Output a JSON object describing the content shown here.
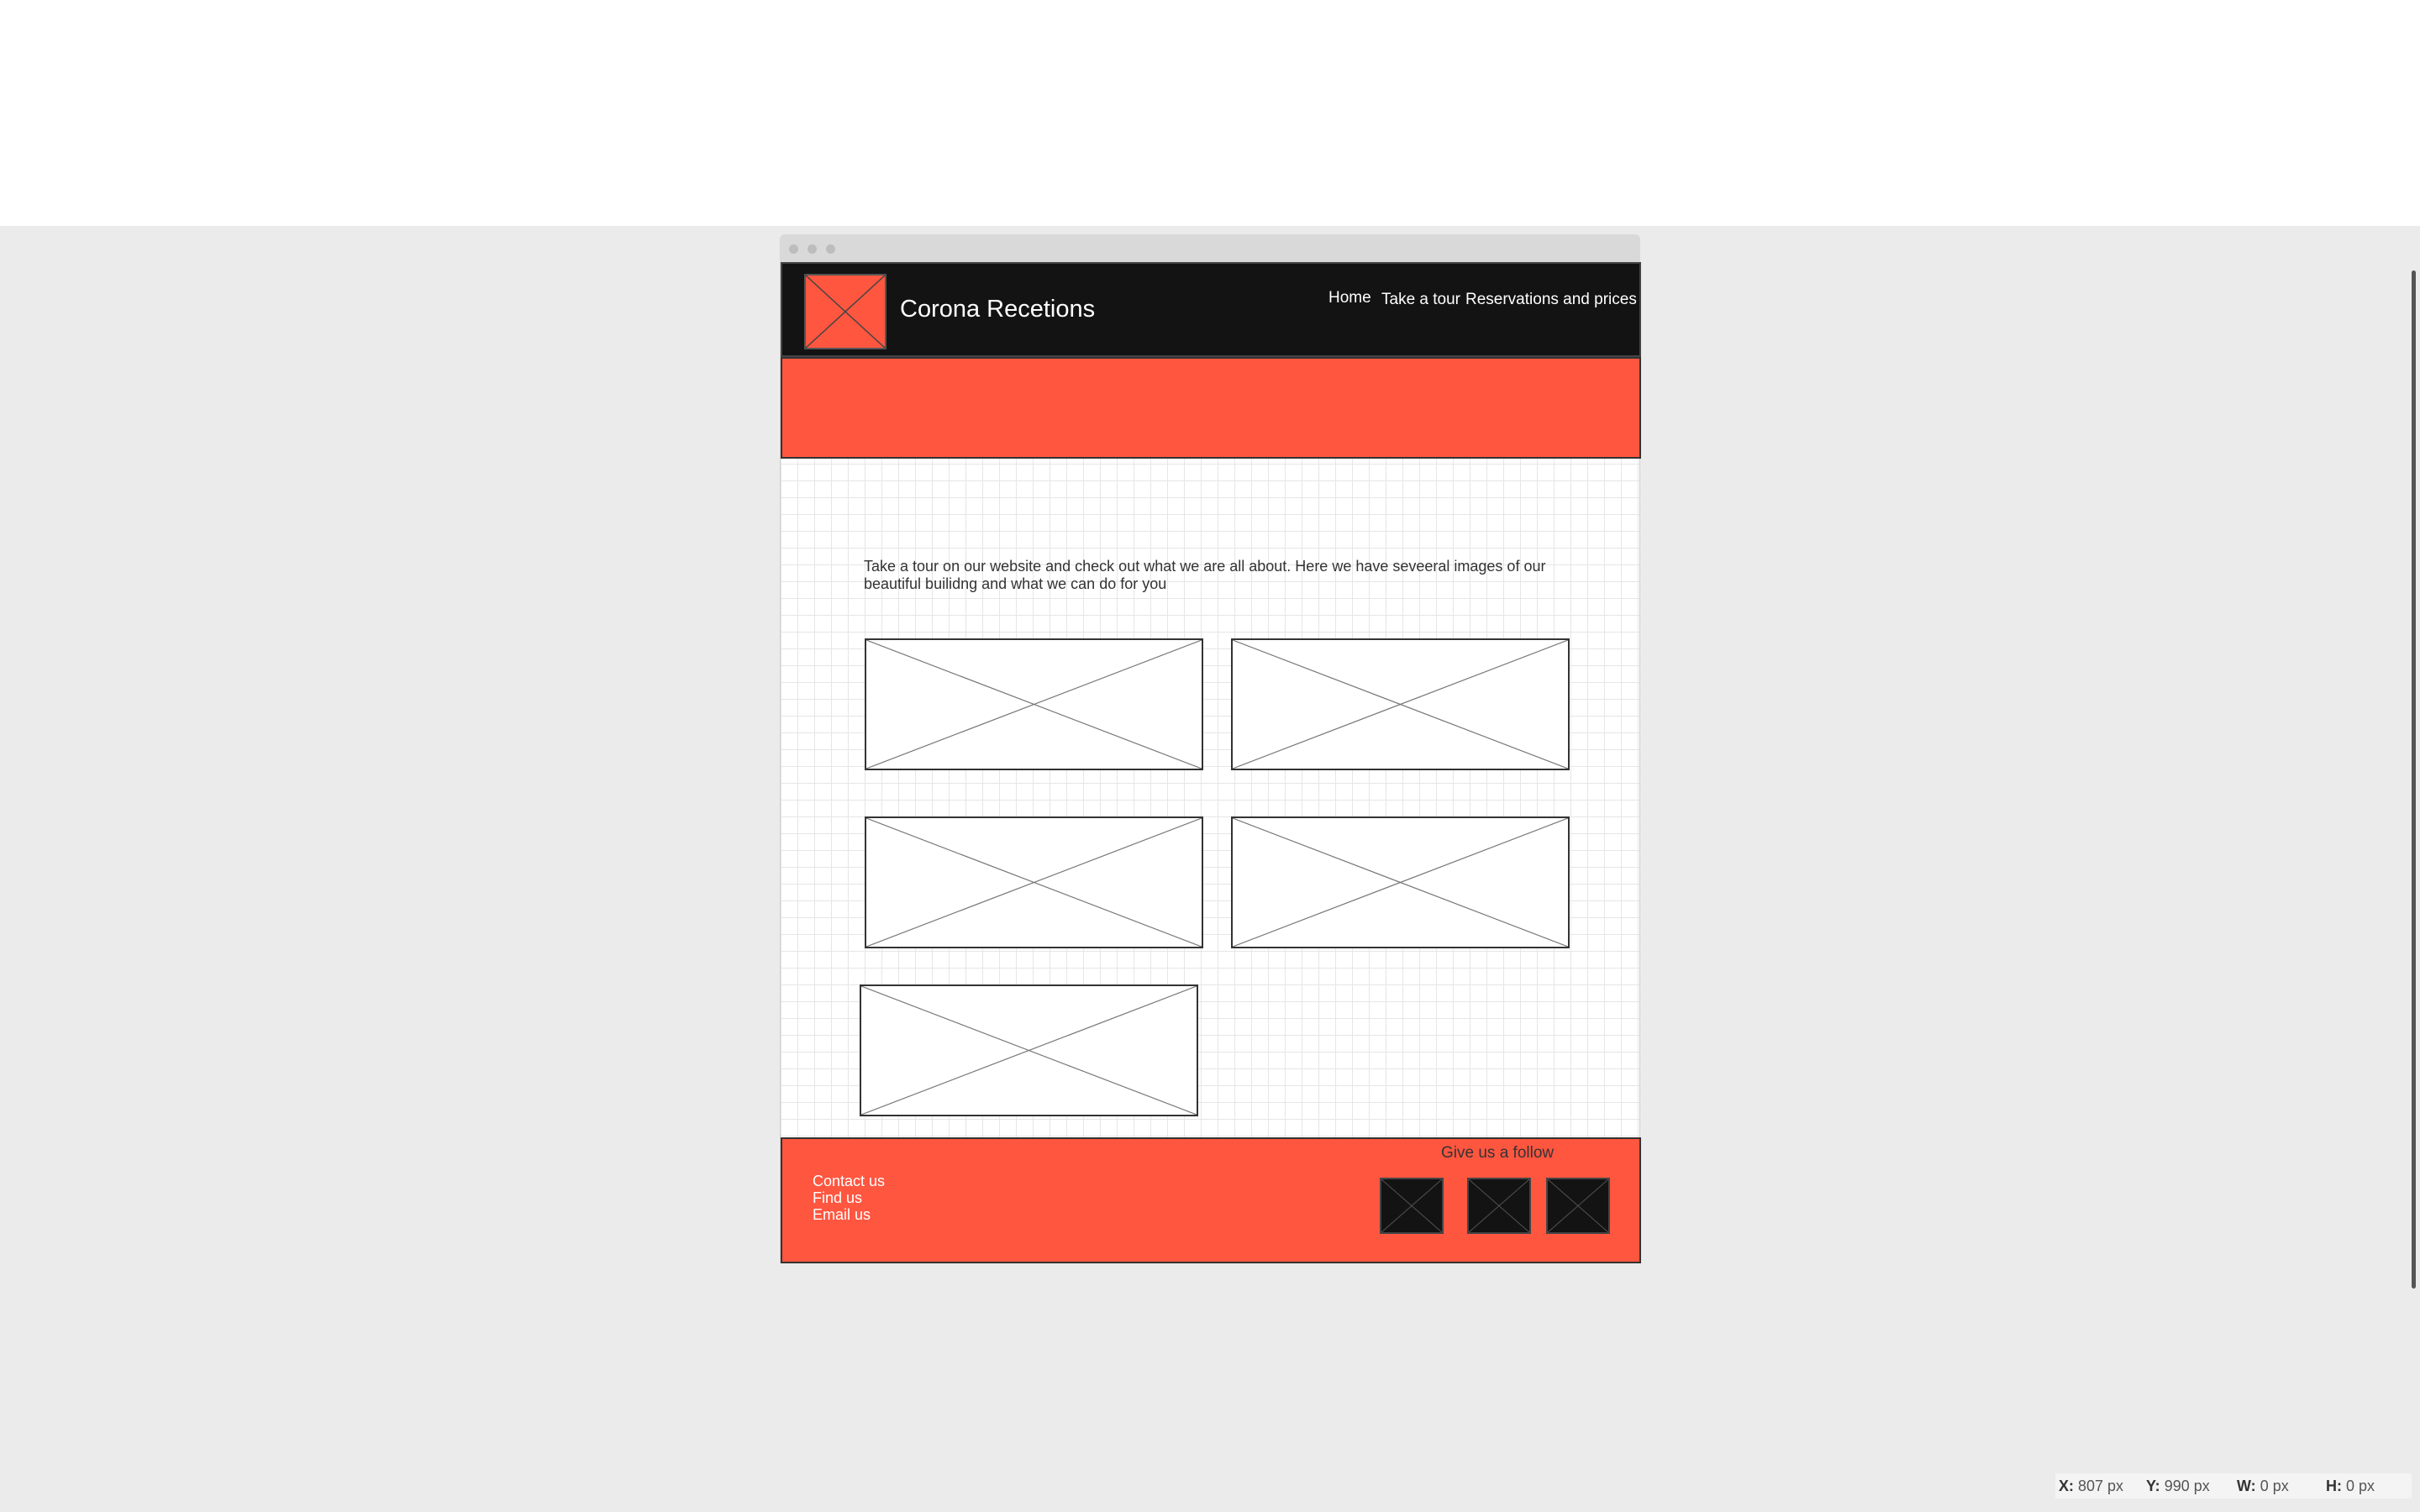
{
  "site": {
    "title": "Corona Recetions",
    "nav": [
      "Home",
      "Take a tour",
      "Reservations and prices"
    ],
    "intro": "Take a tour on our website and check out what we are all about. Here we have seveeral images of our beautiful builidng and what we can do for you"
  },
  "footer": {
    "links": [
      "Contact us",
      "Find us",
      "Email us"
    ],
    "follow": "Give us a follow"
  },
  "status": {
    "x_label": "X:",
    "x_value": "807 px",
    "y_label": "Y:",
    "y_value": "990 px",
    "w_label": "W:",
    "w_value": "0 px",
    "h_label": "H:",
    "h_value": "0 px"
  },
  "colors": {
    "accent": "#ff5640",
    "header": "#131313",
    "canvas": "#ebebeb"
  },
  "icons": {
    "placeholder": "image-placeholder-icon",
    "social": "social-placeholder-icon"
  }
}
